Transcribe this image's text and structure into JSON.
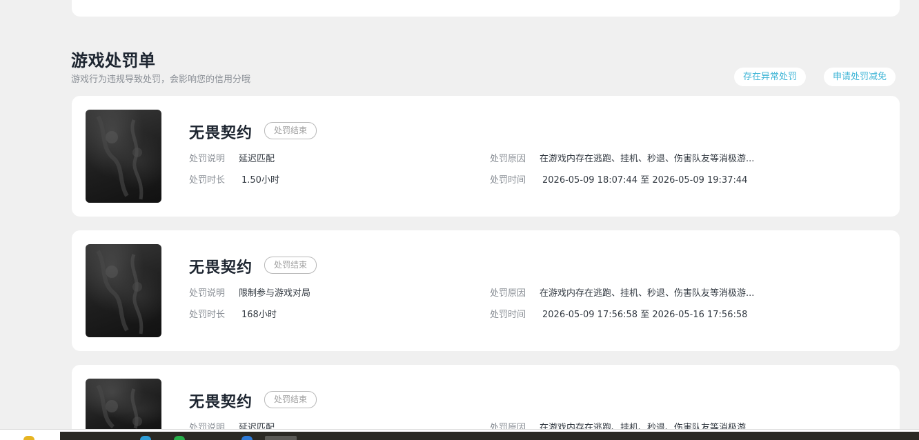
{
  "section": {
    "title": "游戏处罚单",
    "subtitle": "游戏行为违规导致处罚，会影响您的信用分哦",
    "abnormal_button": "存在异常处罚",
    "reduce_button": "申请处罚减免"
  },
  "labels": {
    "description": "处罚说明",
    "reason": "处罚原因",
    "duration": "处罚时长",
    "time": "处罚时间"
  },
  "penalties": [
    {
      "game": "无畏契约",
      "status": "处罚结束",
      "description": "延迟匹配",
      "reason": "在游戏内存在逃跑、挂机、秒退、伤害队友等消极游...",
      "duration": "1.50小时",
      "time": "2026-05-09 18:07:44 至 2026-05-09 19:37:44"
    },
    {
      "game": "无畏契约",
      "status": "处罚结束",
      "description": "限制参与游戏对局",
      "reason": "在游戏内存在逃跑、挂机、秒退、伤害队友等消极游...",
      "duration": "168小时",
      "time": "2026-05-09 17:56:58 至 2026-05-16 17:56:58"
    },
    {
      "game": "无畏契约",
      "status": "处罚结束",
      "description": "延迟匹配",
      "reason": "在游戏内存在逃跑、挂机、秒退、伤害队友等消极游..."
    }
  ],
  "colors": {
    "accent": "#3fb5d6",
    "background": "#f0f0f0",
    "card": "#ffffff",
    "title": "#1d2530",
    "label": "#8a8f96"
  },
  "icons": {
    "taskbar": [
      "folder-icon",
      "chrome-icon",
      "wechat-icon",
      "edge-icon",
      "app-icon"
    ]
  }
}
